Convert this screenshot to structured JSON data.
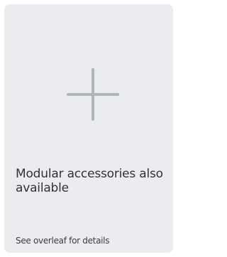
{
  "card": {
    "icon": "plus-icon",
    "title": "Modular accessories also available",
    "details": "See overleaf for details"
  },
  "colors": {
    "card_background": "#ebecf0",
    "icon": "#adb5bd",
    "text": "#2f3237"
  }
}
